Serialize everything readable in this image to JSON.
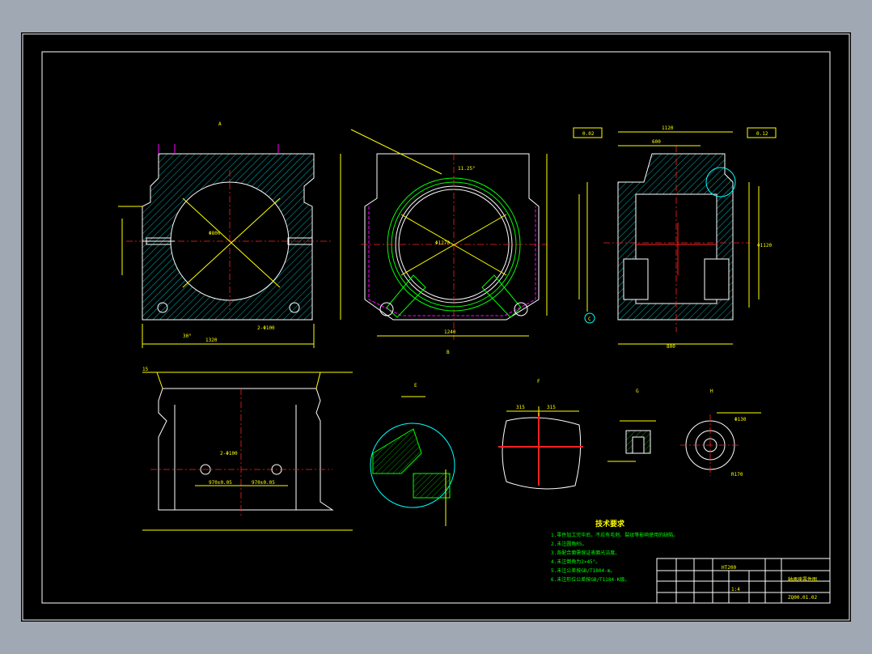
{
  "drawing": {
    "technical_requirements": {
      "title": "技术要求",
      "items": [
        "1.零件加工完毕后，不应有毛刺、裂纹等影响使用的缺陷。",
        "2.未注圆角R5。",
        "3.各配合面需保证表面光洁度。",
        "4.未注倒角为2×45°。",
        "5.未注公差按GB/T1804-m。",
        "6.未注形位公差按GB/T1184-K级。"
      ]
    },
    "title_block": {
      "part_name": "轴承座零件图",
      "drawing_no": "ZQ00.01.02",
      "material": "HT200",
      "scale": "1:4"
    },
    "view_labels": {
      "front": "A",
      "section_b": "B",
      "side": "C",
      "detail_e": "E",
      "detail_f": "F",
      "detail_g": "G",
      "detail_h": "H"
    },
    "dimensions": {
      "front_bore": "Φ800",
      "front_width": "1320",
      "bolt_holes": "2-Φ100",
      "angle_30": "30°",
      "section_bore": "Φ1270",
      "section_width": "1240",
      "section_angle": "11.25°",
      "side_width": "1120",
      "side_top": "600",
      "side_bottom": "800",
      "side_right": "Φ1120",
      "tol_a": "0.02",
      "tol_b": "0.12",
      "bottom_span_1": "970±0.05",
      "bottom_span_2": "970±0.05",
      "bottom_holes": "2-Φ100",
      "dim_15": "15",
      "detail_f_1": "315",
      "detail_f_2": "315",
      "detail_h_1": "Φ130",
      "detail_h_2": "R170"
    }
  }
}
